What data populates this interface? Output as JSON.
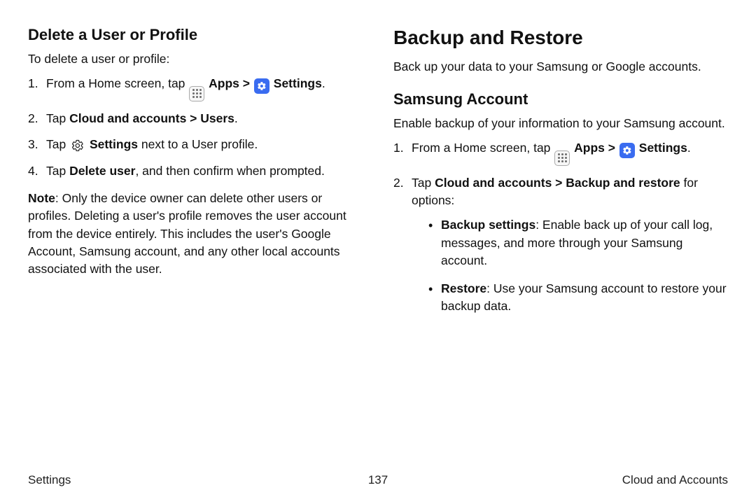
{
  "left": {
    "heading": "Delete a User or Profile",
    "intro": "To delete a user or profile:",
    "step1_a": "From a Home screen, tap ",
    "apps_label": "Apps",
    "chev": ">",
    "settings_label": "Settings",
    "period": ".",
    "step2_a": "Tap ",
    "step2_b": "Cloud and accounts > Users",
    "step3_a": "Tap ",
    "step3_b": " Settings",
    "step3_c": " next to a User profile.",
    "step4_a": "Tap ",
    "step4_b": "Delete user",
    "step4_c": ", and then confirm when prompted.",
    "note_label": "Note",
    "note_body": ": Only the device owner can delete other users or profiles. Deleting a user's profile removes the user account from the device entirely. This includes the user's Google Account, Samsung account, and any other local accounts associated with the user."
  },
  "right": {
    "heading": "Backup and Restore",
    "intro": "Back up your data to your Samsung or Google accounts.",
    "sub": "Samsung Account",
    "subintro": "Enable backup of your information to your Samsung account.",
    "step1_a": "From a Home screen, tap ",
    "apps_label": "Apps",
    "chev": ">",
    "settings_label": "Settings",
    "period": ".",
    "step2_a": "Tap ",
    "step2_b": "Cloud and accounts > Backup and restore",
    "step2_c": " for options:",
    "bullet1_a": "Backup settings",
    "bullet1_b": ": Enable back up of your call log, messages, and more through your Samsung account.",
    "bullet2_a": "Restore",
    "bullet2_b": ": Use your Samsung account to restore your backup data."
  },
  "footer": {
    "left": "Settings",
    "center": "137",
    "right": "Cloud and Accounts"
  }
}
